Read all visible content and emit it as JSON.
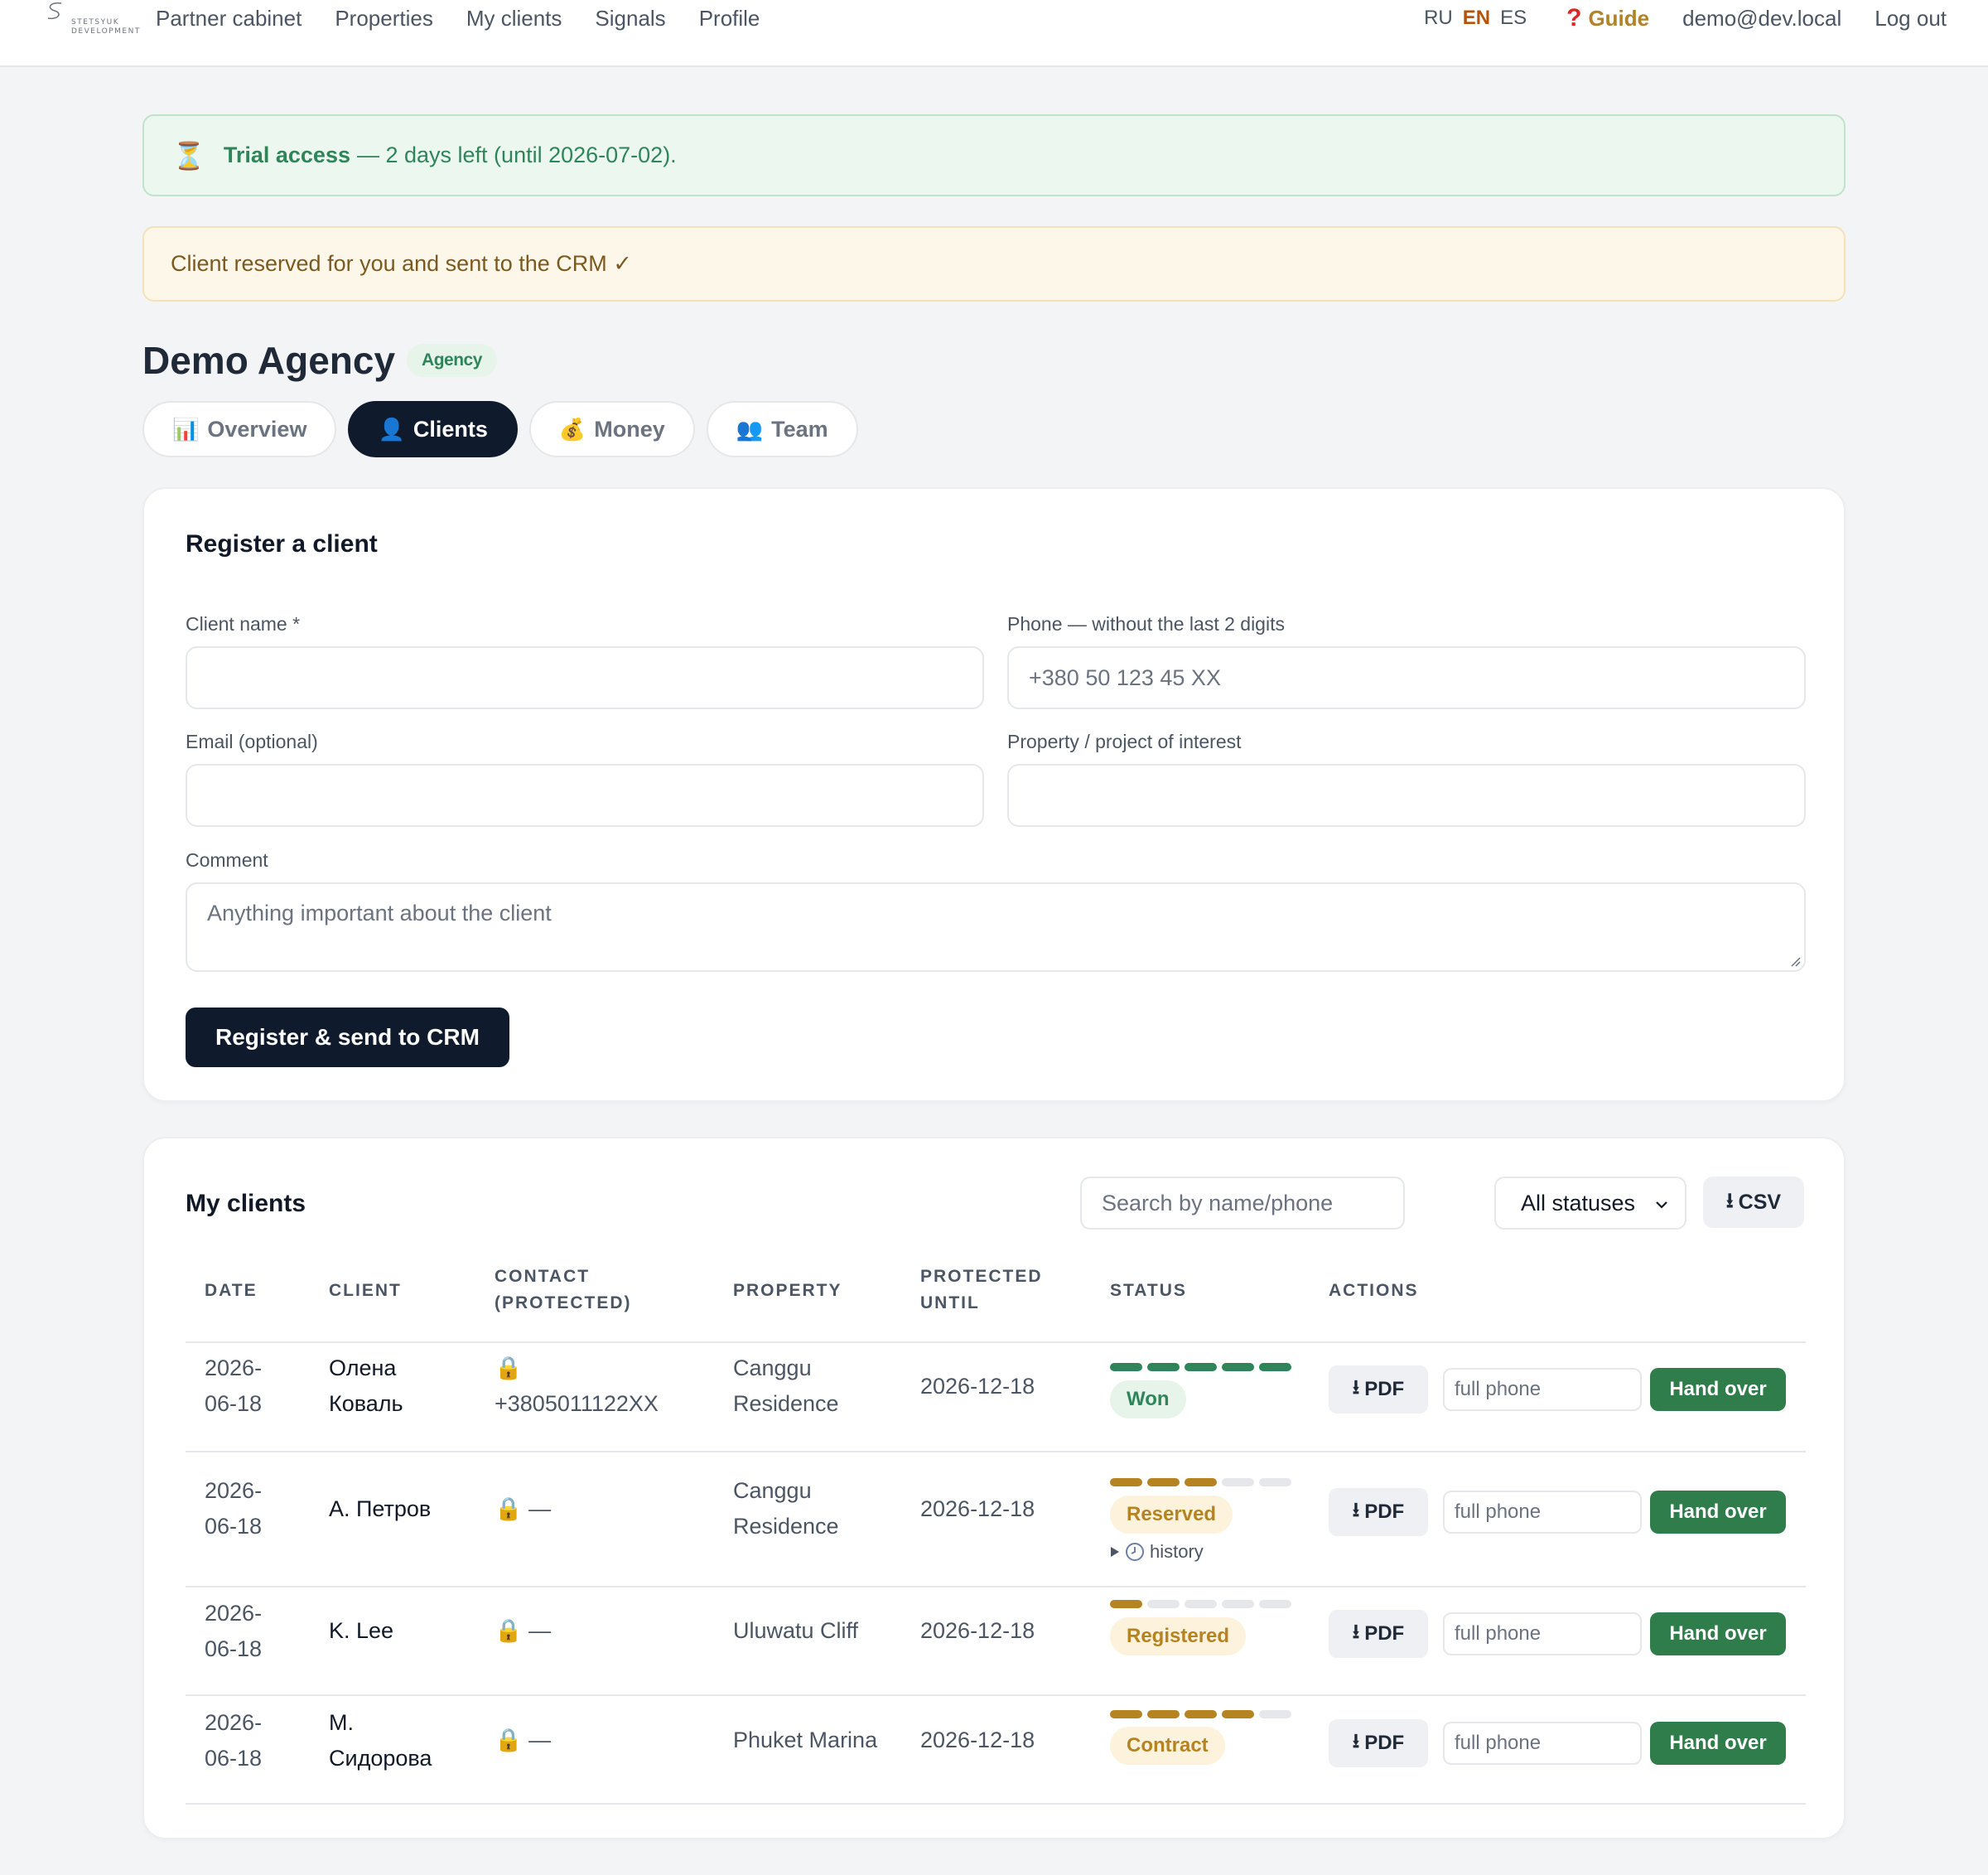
{
  "nav": {
    "logo_text": "STETSYUK DEVELOPMENT",
    "links": [
      "Partner cabinet",
      "Properties",
      "My clients",
      "Signals",
      "Profile"
    ],
    "langs": [
      "RU",
      "EN",
      "ES"
    ],
    "active_lang": "EN",
    "guide": "Guide",
    "email": "demo@dev.local",
    "logout": "Log out"
  },
  "alerts": {
    "trial_bold": "Trial access",
    "trial_rest": "— 2 days left (until 2026-07-02).",
    "reserved": "Client reserved for you and sent to the CRM ✓"
  },
  "agency": {
    "title": "Demo Agency",
    "badge": "Agency"
  },
  "tabs": [
    {
      "icon": "📊",
      "label": "Overview",
      "active": false
    },
    {
      "icon": "👤",
      "label": "Clients",
      "active": true
    },
    {
      "icon": "💰",
      "label": "Money",
      "active": false
    },
    {
      "icon": "👥",
      "label": "Team",
      "active": false
    }
  ],
  "register": {
    "title": "Register a client",
    "name_label": "Client name *",
    "name_value": "",
    "phone_label": "Phone — without the last 2 digits",
    "phone_placeholder": "+380 50 123 45 XX",
    "email_label": "Email (optional)",
    "email_value": "",
    "property_label": "Property / project of interest",
    "property_value": "",
    "comment_label": "Comment",
    "comment_placeholder": "Anything important about the client",
    "submit": "Register & send to CRM"
  },
  "clients": {
    "title": "My clients",
    "search_placeholder": "Search by name/phone",
    "status_filter": "All statuses",
    "csv": "CSV",
    "headers": {
      "date": "DATE",
      "client": "CLIENT",
      "contact_1": "CONTACT",
      "contact_2": "(PROTECTED)",
      "property": "PROPERTY",
      "protected_1": "PROTECTED",
      "protected_2": "UNTIL",
      "status": "STATUS",
      "actions": "ACTIONS"
    },
    "rows": [
      {
        "date_1": "2026-",
        "date_2": "06-18",
        "client_1": "Олена",
        "client_2": "Коваль",
        "lock": "🔒",
        "contact": "+3805011122XX",
        "property_1": "Canggu",
        "property_2": "Residence",
        "until": "2026-12-18",
        "status": "Won",
        "progress": 5,
        "history": ""
      },
      {
        "date_1": "2026-",
        "date_2": "06-18",
        "client_1": "А. Петров",
        "client_2": "",
        "lock": "🔒",
        "contact": "—",
        "property_1": "Canggu",
        "property_2": "Residence",
        "until": "2026-12-18",
        "status": "Reserved",
        "progress": 3,
        "history": "history"
      },
      {
        "date_1": "2026-",
        "date_2": "06-18",
        "client_1": "K. Lee",
        "client_2": "",
        "lock": "🔒",
        "contact": "—",
        "property_1": "Uluwatu Cliff",
        "property_2": "",
        "until": "2026-12-18",
        "status": "Registered",
        "progress": 1,
        "history": ""
      },
      {
        "date_1": "2026-",
        "date_2": "06-18",
        "client_1": "М.",
        "client_2": "Сидорова",
        "lock": "🔒",
        "contact": "—",
        "property_1": "Phuket Marina",
        "property_2": "",
        "until": "2026-12-18",
        "status": "Contract",
        "progress": 4,
        "history": ""
      }
    ],
    "actions": {
      "pdf": "PDF",
      "phone_placeholder": "full phone",
      "hand_over": "Hand over"
    }
  },
  "colors": {
    "won": "#2f855a",
    "amber": "#b58420",
    "track": "#e5e7eb",
    "dark": "#0f1b2d"
  }
}
